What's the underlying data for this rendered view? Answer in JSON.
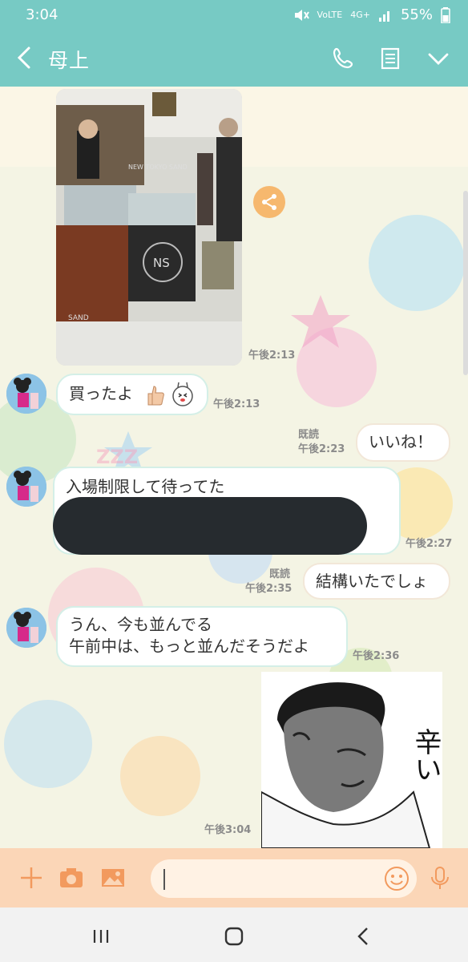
{
  "status_bar": {
    "time": "3:04",
    "network": "4G+",
    "lte": "VoLTE",
    "battery": "55%"
  },
  "header": {
    "title": "母上"
  },
  "messages": [
    {
      "sender": "mother",
      "kind": "photo",
      "time": "午後2:13"
    },
    {
      "sender": "mother",
      "kind": "text",
      "text": "買ったよ",
      "time": "午後2:13"
    },
    {
      "sender": "me",
      "kind": "text",
      "text": "いいね！",
      "read": "既読",
      "time": "午後2:23"
    },
    {
      "sender": "mother",
      "kind": "text",
      "text": "入場制限して待ってた",
      "time": "午後2:27"
    },
    {
      "sender": "me",
      "kind": "text",
      "text": "結構いたでしょ",
      "read": "既読",
      "time": "午後2:35"
    },
    {
      "sender": "mother",
      "kind": "text",
      "lines": [
        "うん、今も並んでる",
        "午前中は、もっと並んだそうだよ"
      ],
      "time": "午後2:36"
    },
    {
      "sender": "me",
      "kind": "sticker",
      "sticker_text": "辛い",
      "time": "午後3:04"
    }
  ],
  "photo_signage": {
    "logo": "NS",
    "ring_text": "NEW TOKYO SAND",
    "shelf_sign": "SAND"
  },
  "colors": {
    "header": "#77cac4",
    "input_bar": "#fbd6b7",
    "accent": "#f29a5e"
  },
  "icons": [
    "back-icon",
    "phone-icon",
    "notes-icon",
    "chevron-down-icon",
    "share-icon",
    "plus-icon",
    "camera-icon",
    "image-icon",
    "emoji-icon",
    "mic-icon",
    "recent-apps-icon",
    "home-icon",
    "nav-back-icon"
  ]
}
